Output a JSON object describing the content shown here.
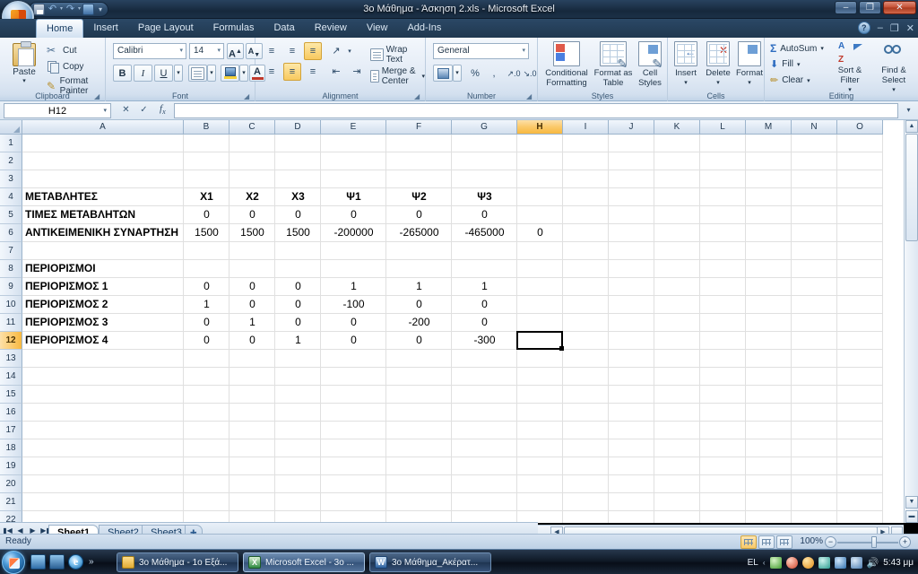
{
  "window": {
    "title": "3ο Μάθημα - Άσκηση 2.xls - Microsoft Excel",
    "minimize": "–",
    "maximize": "❐",
    "close": "✕",
    "inner_minimize": "–",
    "inner_restore": "❐",
    "inner_close": "✕"
  },
  "quick_access": {
    "save": "save-icon",
    "undo": "↶",
    "redo": "↷",
    "print_preview": "print-preview-icon",
    "customize": "▾"
  },
  "office_button": "office-orb",
  "ribbon": {
    "tabs": [
      {
        "label": "Home",
        "active": true
      },
      {
        "label": "Insert",
        "active": false
      },
      {
        "label": "Page Layout",
        "active": false
      },
      {
        "label": "Formulas",
        "active": false
      },
      {
        "label": "Data",
        "active": false
      },
      {
        "label": "Review",
        "active": false
      },
      {
        "label": "View",
        "active": false
      },
      {
        "label": "Add-Ins",
        "active": false
      }
    ],
    "groups": {
      "clipboard": {
        "label": "Clipboard",
        "paste": "Paste",
        "cut": "Cut",
        "copy": "Copy",
        "format_painter": "Format Painter"
      },
      "font": {
        "label": "Font",
        "font_name": "Calibri",
        "font_size": "14",
        "grow_font": "A",
        "shrink_font": "A",
        "bold": "B",
        "italic": "I",
        "underline": "U",
        "borders": "borders-icon",
        "fill_color": "fill-color-icon",
        "font_color": "A"
      },
      "alignment": {
        "label": "Alignment",
        "align_top": "align-top-icon",
        "align_middle": "align-middle-icon",
        "align_bottom": "align-bottom-icon",
        "orientation": "orientation-icon",
        "align_left": "align-left-icon",
        "align_center": "align-center-icon",
        "align_right": "align-right-icon",
        "decrease_indent": "decrease-indent-icon",
        "increase_indent": "increase-indent-icon",
        "wrap_text": "Wrap Text",
        "merge_center": "Merge & Center"
      },
      "number": {
        "label": "Number",
        "format": "General",
        "accounting": "accounting-format-icon",
        "percent": "%",
        "comma": ",",
        "increase_decimal": "increase-decimal-icon",
        "decrease_decimal": "decrease-decimal-icon"
      },
      "styles": {
        "label": "Styles",
        "conditional_formatting": "Conditional Formatting",
        "format_as_table": "Format as Table",
        "cell_styles": "Cell Styles"
      },
      "cells": {
        "label": "Cells",
        "insert": "Insert",
        "delete": "Delete",
        "format": "Format"
      },
      "editing": {
        "label": "Editing",
        "autosum": "AutoSum",
        "fill": "Fill",
        "clear": "Clear",
        "sort_filter": "Sort & Filter",
        "find_select": "Find & Select"
      }
    }
  },
  "formula_bar": {
    "name_box": "H12",
    "formula": "",
    "fx_label": "fx",
    "insert_function": "fx"
  },
  "grid": {
    "columns": [
      "A",
      "B",
      "C",
      "D",
      "E",
      "F",
      "G",
      "H",
      "I",
      "J",
      "K",
      "L",
      "M",
      "N",
      "O"
    ],
    "selected_column": "H",
    "selected_row": 12,
    "selected_cell": "H12",
    "rows": [
      1,
      2,
      3,
      4,
      5,
      6,
      7,
      8,
      9,
      10,
      11,
      12,
      13,
      14,
      15,
      16,
      17,
      18,
      19,
      20,
      21,
      22
    ],
    "cells": [
      {
        "row": 4,
        "col": "A",
        "value": "ΜΕΤΑΒΛΗΤΕΣ",
        "bold": true,
        "align": "left"
      },
      {
        "row": 4,
        "col": "B",
        "value": "X1",
        "bold": true,
        "align": "center"
      },
      {
        "row": 4,
        "col": "C",
        "value": "X2",
        "bold": true,
        "align": "center"
      },
      {
        "row": 4,
        "col": "D",
        "value": "X3",
        "bold": true,
        "align": "center"
      },
      {
        "row": 4,
        "col": "E",
        "value": "Ψ1",
        "bold": true,
        "align": "center"
      },
      {
        "row": 4,
        "col": "F",
        "value": "Ψ2",
        "bold": true,
        "align": "center"
      },
      {
        "row": 4,
        "col": "G",
        "value": "Ψ3",
        "bold": true,
        "align": "center"
      },
      {
        "row": 5,
        "col": "A",
        "value": "ΤΙΜΕΣ ΜΕΤΑΒΛΗΤΩΝ",
        "bold": true,
        "align": "left"
      },
      {
        "row": 5,
        "col": "B",
        "value": "0",
        "bold": false,
        "align": "center"
      },
      {
        "row": 5,
        "col": "C",
        "value": "0",
        "bold": false,
        "align": "center"
      },
      {
        "row": 5,
        "col": "D",
        "value": "0",
        "bold": false,
        "align": "center"
      },
      {
        "row": 5,
        "col": "E",
        "value": "0",
        "bold": false,
        "align": "center"
      },
      {
        "row": 5,
        "col": "F",
        "value": "0",
        "bold": false,
        "align": "center"
      },
      {
        "row": 5,
        "col": "G",
        "value": "0",
        "bold": false,
        "align": "center"
      },
      {
        "row": 6,
        "col": "A",
        "value": "ΑΝΤΙΚΕΙΜΕΝΙΚΗ ΣΥΝΑΡΤΗΣΗ",
        "bold": true,
        "align": "left"
      },
      {
        "row": 6,
        "col": "B",
        "value": "1500",
        "bold": false,
        "align": "center"
      },
      {
        "row": 6,
        "col": "C",
        "value": "1500",
        "bold": false,
        "align": "center"
      },
      {
        "row": 6,
        "col": "D",
        "value": "1500",
        "bold": false,
        "align": "center"
      },
      {
        "row": 6,
        "col": "E",
        "value": "-200000",
        "bold": false,
        "align": "center"
      },
      {
        "row": 6,
        "col": "F",
        "value": "-265000",
        "bold": false,
        "align": "center"
      },
      {
        "row": 6,
        "col": "G",
        "value": "-465000",
        "bold": false,
        "align": "center"
      },
      {
        "row": 6,
        "col": "H",
        "value": "0",
        "bold": false,
        "align": "center"
      },
      {
        "row": 8,
        "col": "A",
        "value": "ΠΕΡΙΟΡΙΣΜΟΙ",
        "bold": true,
        "align": "left"
      },
      {
        "row": 9,
        "col": "A",
        "value": "ΠΕΡΙΟΡΙΣΜΟΣ 1",
        "bold": true,
        "align": "left"
      },
      {
        "row": 9,
        "col": "B",
        "value": "0",
        "bold": false,
        "align": "center"
      },
      {
        "row": 9,
        "col": "C",
        "value": "0",
        "bold": false,
        "align": "center"
      },
      {
        "row": 9,
        "col": "D",
        "value": "0",
        "bold": false,
        "align": "center"
      },
      {
        "row": 9,
        "col": "E",
        "value": "1",
        "bold": false,
        "align": "center"
      },
      {
        "row": 9,
        "col": "F",
        "value": "1",
        "bold": false,
        "align": "center"
      },
      {
        "row": 9,
        "col": "G",
        "value": "1",
        "bold": false,
        "align": "center"
      },
      {
        "row": 10,
        "col": "A",
        "value": "ΠΕΡΙΟΡΙΣΜΟΣ 2",
        "bold": true,
        "align": "left"
      },
      {
        "row": 10,
        "col": "B",
        "value": "1",
        "bold": false,
        "align": "center"
      },
      {
        "row": 10,
        "col": "C",
        "value": "0",
        "bold": false,
        "align": "center"
      },
      {
        "row": 10,
        "col": "D",
        "value": "0",
        "bold": false,
        "align": "center"
      },
      {
        "row": 10,
        "col": "E",
        "value": "-100",
        "bold": false,
        "align": "center"
      },
      {
        "row": 10,
        "col": "F",
        "value": "0",
        "bold": false,
        "align": "center"
      },
      {
        "row": 10,
        "col": "G",
        "value": "0",
        "bold": false,
        "align": "center"
      },
      {
        "row": 11,
        "col": "A",
        "value": "ΠΕΡΙΟΡΙΣΜΟΣ 3",
        "bold": true,
        "align": "left"
      },
      {
        "row": 11,
        "col": "B",
        "value": "0",
        "bold": false,
        "align": "center"
      },
      {
        "row": 11,
        "col": "C",
        "value": "1",
        "bold": false,
        "align": "center"
      },
      {
        "row": 11,
        "col": "D",
        "value": "0",
        "bold": false,
        "align": "center"
      },
      {
        "row": 11,
        "col": "E",
        "value": "0",
        "bold": false,
        "align": "center"
      },
      {
        "row": 11,
        "col": "F",
        "value": "-200",
        "bold": false,
        "align": "center"
      },
      {
        "row": 11,
        "col": "G",
        "value": "0",
        "bold": false,
        "align": "center"
      },
      {
        "row": 12,
        "col": "A",
        "value": "ΠΕΡΙΟΡΙΣΜΟΣ 4",
        "bold": true,
        "align": "left"
      },
      {
        "row": 12,
        "col": "B",
        "value": "0",
        "bold": false,
        "align": "center"
      },
      {
        "row": 12,
        "col": "C",
        "value": "0",
        "bold": false,
        "align": "center"
      },
      {
        "row": 12,
        "col": "D",
        "value": "1",
        "bold": false,
        "align": "center"
      },
      {
        "row": 12,
        "col": "E",
        "value": "0",
        "bold": false,
        "align": "center"
      },
      {
        "row": 12,
        "col": "F",
        "value": "0",
        "bold": false,
        "align": "center"
      },
      {
        "row": 12,
        "col": "G",
        "value": "-300",
        "bold": false,
        "align": "center"
      }
    ]
  },
  "sheet_tabs": {
    "first": "⏮",
    "prev": "◀",
    "next": "▶",
    "last": "⏭",
    "tabs": [
      {
        "label": "Sheet1",
        "active": true
      },
      {
        "label": "Sheet2",
        "active": false
      },
      {
        "label": "Sheet3",
        "active": false
      }
    ],
    "insert_sheet": "insert-worksheet-icon"
  },
  "status_bar": {
    "status": "Ready",
    "view_normal": "normal-view-icon",
    "view_page_layout": "page-layout-view-icon",
    "view_page_break": "page-break-view-icon",
    "zoom": "100%",
    "zoom_out": "−",
    "zoom_in": "+"
  },
  "taskbar": {
    "start": "start-orb",
    "quick_launch": [
      "show-desktop-icon",
      "flip-3d-icon",
      "internet-explorer-icon"
    ],
    "quick_launch_more": "»",
    "tasks": [
      {
        "label": "3ο Μάθημα - 1ο Εξά...",
        "icon": "folder-icon",
        "active": false
      },
      {
        "label": "Microsoft Excel - 3ο ...",
        "icon": "excel-icon",
        "active": true
      },
      {
        "label": "3ο Μάθημα_Ακέρατ...",
        "icon": "word-icon",
        "active": false
      }
    ],
    "tray": {
      "language": "EL",
      "expand": "‹",
      "icons": [
        "antivirus-icon",
        "adobe-icon",
        "update-icon",
        "network-signal-icon",
        "usb-icon",
        "network-icon"
      ],
      "volume": "🔊",
      "clock": "5:43 μμ"
    }
  }
}
